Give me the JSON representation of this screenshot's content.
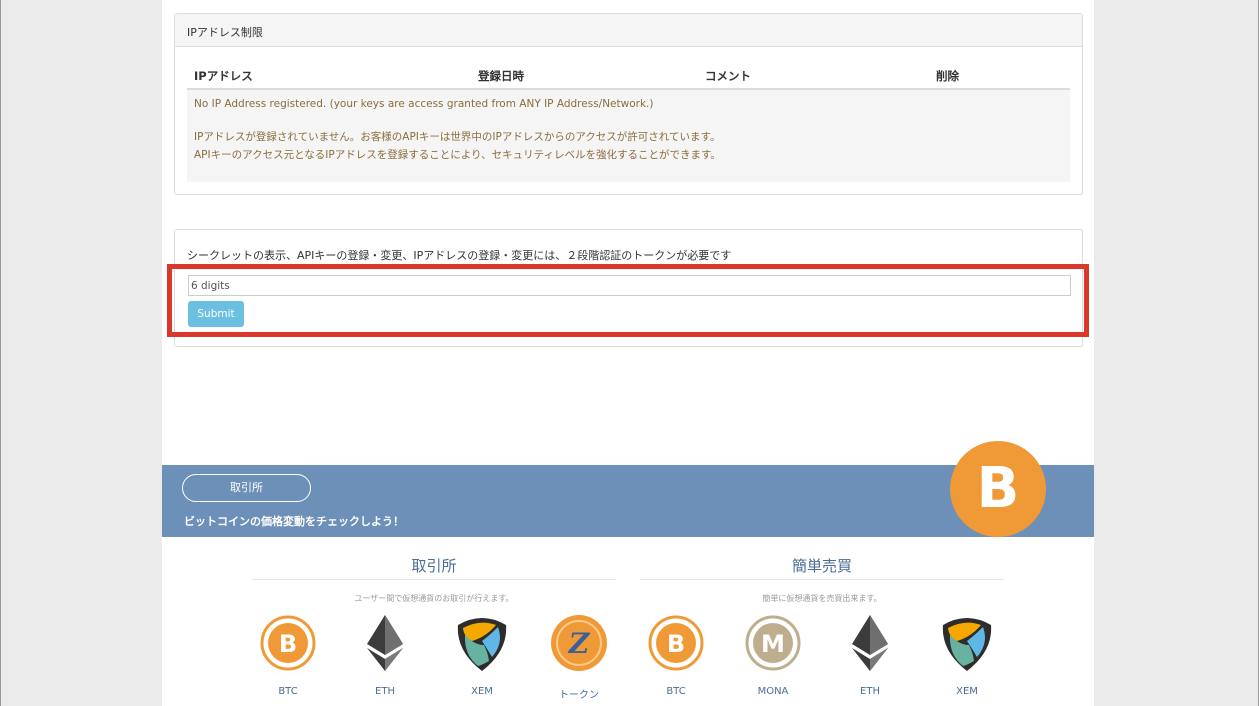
{
  "ip_panel": {
    "title": "IPアドレス制限",
    "columns": [
      "IPアドレス",
      "登録日時",
      "コメント",
      "削除"
    ],
    "empty_en": "No IP Address registered. (your keys are access granted from ANY IP Address/Network.)",
    "empty_jp_1": "IPアドレスが登録されていません。お客様のAPIキーは世界中のIPアドレスからのアクセスが許可されています。",
    "empty_jp_2": "APIキーのアクセス元となるIPアドレスを登録することにより、セキュリティレベルを強化することができます。"
  },
  "twofa": {
    "hint": "シークレットの表示、APIキーの登録・変更、IPアドレスの登録・変更には、２段階認証のトークンが必要です",
    "placeholder": "6 digits",
    "submit_label": "Submit",
    "highlight_color": "#d9382b"
  },
  "banner": {
    "button_label": "取引所",
    "text": "ビットコインの価格変動をチェックしよう！",
    "coin_symbol": "B",
    "background": "#6d90b8"
  },
  "exchange": {
    "title": "取引所",
    "subtitle": "ユーザー間で仮想通貨のお取引が行えます。",
    "coins": [
      {
        "label": "BTC",
        "icon": "bitcoin-icon"
      },
      {
        "label": "ETH",
        "icon": "ethereum-icon"
      },
      {
        "label": "XEM",
        "icon": "nem-icon"
      },
      {
        "label": "トークン",
        "icon": "zaif-token-icon"
      }
    ]
  },
  "simple": {
    "title": "簡単売買",
    "subtitle": "簡単に仮想通貨を売買出来ます。",
    "coins": [
      {
        "label": "BTC",
        "icon": "bitcoin-icon"
      },
      {
        "label": "MONA",
        "icon": "monacoin-icon"
      },
      {
        "label": "ETH",
        "icon": "ethereum-icon"
      },
      {
        "label": "XEM",
        "icon": "nem-icon"
      }
    ]
  }
}
